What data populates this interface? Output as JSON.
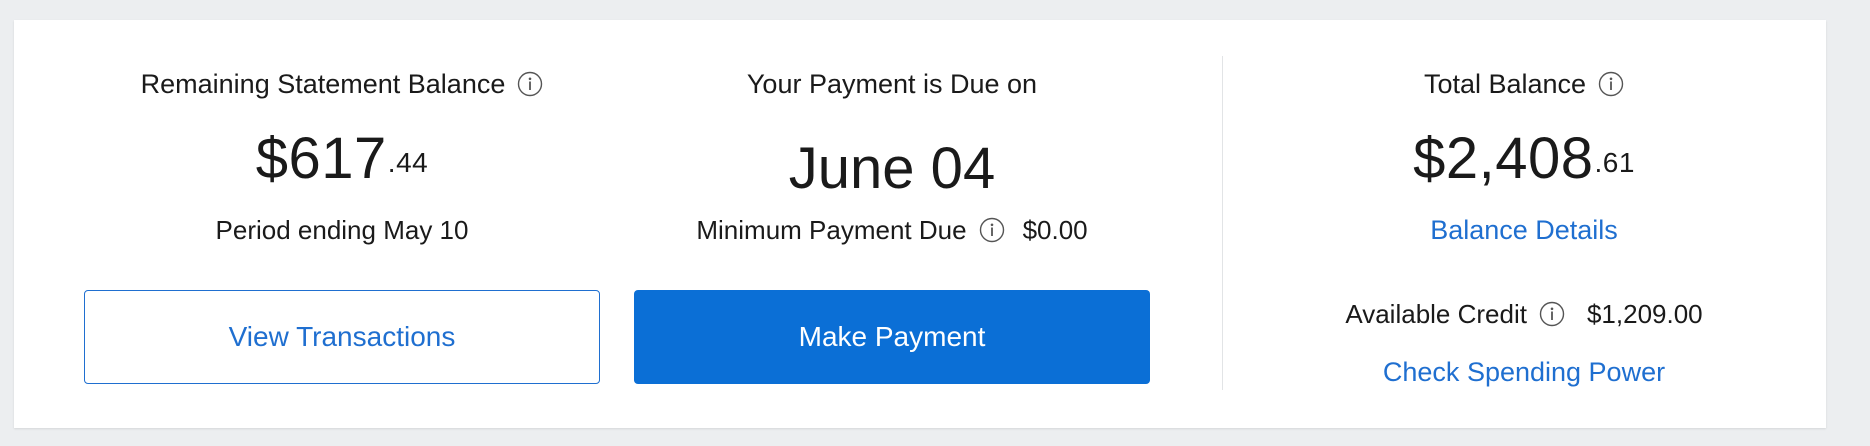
{
  "statement": {
    "heading": "Remaining Statement Balance",
    "amount_dollars": "$617",
    "amount_cents": ".44",
    "period": "Period ending May 10",
    "button_label": "View Transactions"
  },
  "due": {
    "heading": "Your Payment is Due on",
    "date": "June 04",
    "minimum_label": "Minimum Payment Due",
    "minimum_value": "$0.00",
    "button_label": "Make Payment"
  },
  "total": {
    "heading": "Total Balance",
    "amount_dollars": "$2,408",
    "amount_cents": ".61",
    "details_link": "Balance Details",
    "credit_label": "Available Credit",
    "credit_value": "$1,209.00",
    "spending_link": "Check Spending Power"
  },
  "colors": {
    "accent": "#0b6fd6",
    "link": "#1f6fd0",
    "background": "#eceef0",
    "card": "#ffffff"
  },
  "icons": {
    "info": "info-circle-icon"
  }
}
